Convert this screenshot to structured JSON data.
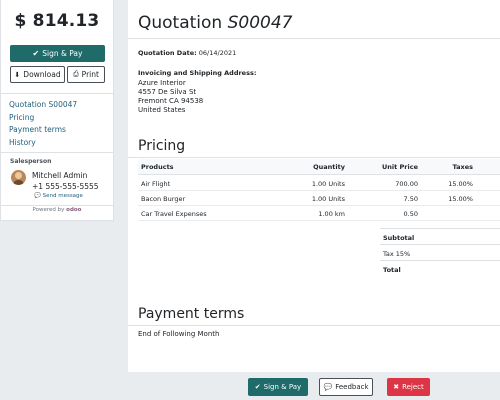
{
  "sidebar": {
    "total": "$ 814.13",
    "sign_pay": "Sign & Pay",
    "download": "Download",
    "print": "Print",
    "nav": [
      "Quotation S00047",
      "Pricing",
      "Payment terms",
      "History"
    ],
    "salesperson_label": "Salesperson",
    "salesperson_name": "Mitchell Admin",
    "salesperson_phone": "+1 555-555-5555",
    "send_message": "Send message",
    "powered_by": "Powered by",
    "powered_brand": "odoo"
  },
  "main": {
    "title_prefix": "Quotation",
    "title_number": "S00047",
    "date_label": "Quotation Date:",
    "date_value": "06/14/2021",
    "address_heading": "Invoicing and Shipping Address:",
    "address": [
      "Azure Interior",
      "4557 De Silva St",
      "Fremont CA 94538",
      "United States"
    ],
    "pricing_heading": "Pricing",
    "columns": {
      "products": "Products",
      "quantity": "Quantity",
      "unit_price": "Unit Price",
      "taxes": "Taxes"
    },
    "lines": [
      {
        "product": "Air Flight",
        "quantity": "1.00 Units",
        "unit_price": "700.00",
        "taxes": "15.00%"
      },
      {
        "product": "Bacon Burger",
        "quantity": "1.00 Units",
        "unit_price": "7.50",
        "taxes": "15.00%"
      },
      {
        "product": "Car Travel Expenses",
        "quantity": "1.00 km",
        "unit_price": "0.50",
        "taxes": ""
      }
    ],
    "subtotal_label": "Subtotal",
    "tax_label": "Tax 15%",
    "total_label": "Total",
    "payment_heading": "Payment terms",
    "payment_text": "End of Following Month"
  },
  "bottom": {
    "sign_pay": "Sign & Pay",
    "feedback": "Feedback",
    "reject": "Reject"
  },
  "colors": {
    "primary": "#1f6b6a",
    "link": "#1f5f7a",
    "danger": "#dc3545"
  }
}
